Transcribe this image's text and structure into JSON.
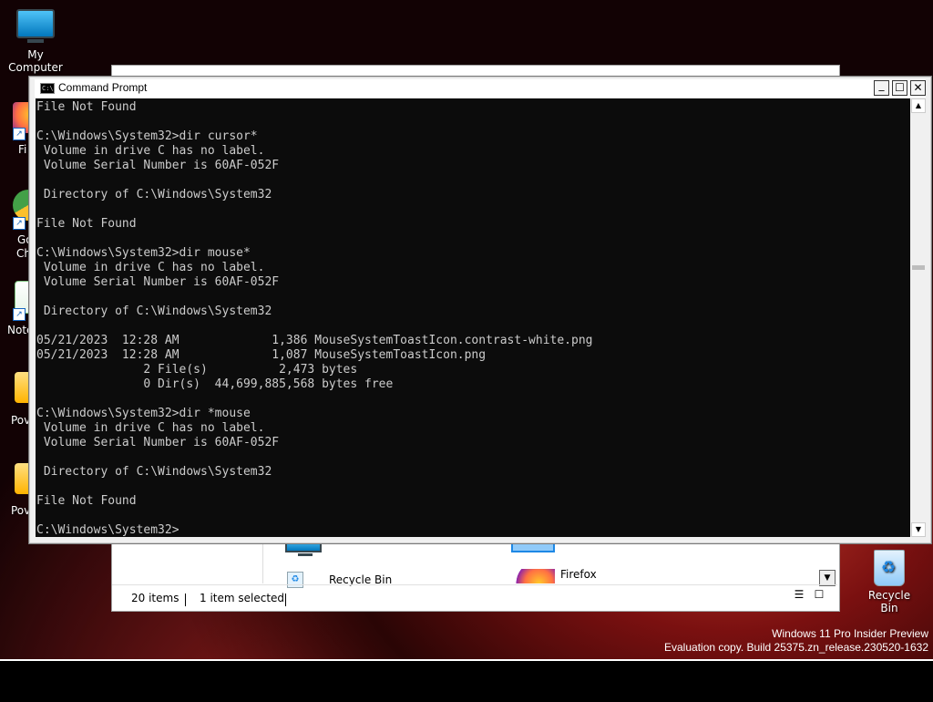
{
  "desktop": {
    "icons": [
      {
        "label": "My Computer",
        "icon": "monitor-icon"
      },
      {
        "label": "Fi",
        "icon": "firefox-icon"
      },
      {
        "label": "Go",
        "label2": "Ch",
        "icon": "chrome-icon"
      },
      {
        "label": "Note",
        "icon": "notepad-icon"
      },
      {
        "label": "Pov",
        "icon": "folder-icon"
      },
      {
        "label": "Pov",
        "icon": "folder-icon"
      }
    ],
    "recycle_bin_label": "Recycle Bin",
    "watermark_line1": "Windows 11 Pro Insider Preview",
    "watermark_line2": "Evaluation copy. Build 25375.zn_release.230520-1632"
  },
  "explorer": {
    "items": [
      {
        "label": "Recycle Bin",
        "icon": "recycle-bin-icon"
      },
      {
        "label": "Firefox",
        "icon": "firefox-icon"
      }
    ],
    "status": {
      "items_count": "20 items",
      "selection": "1 item selected"
    }
  },
  "cmd": {
    "title": "Command Prompt",
    "icon_text": "C:\\",
    "buttons": {
      "minimize": "_",
      "maximize": "☐",
      "close": "✕"
    },
    "output": "File Not Found\n\nC:\\Windows\\System32>dir cursor*\n Volume in drive C has no label.\n Volume Serial Number is 60AF-052F\n\n Directory of C:\\Windows\\System32\n\nFile Not Found\n\nC:\\Windows\\System32>dir mouse*\n Volume in drive C has no label.\n Volume Serial Number is 60AF-052F\n\n Directory of C:\\Windows\\System32\n\n05/21/2023  12:28 AM             1,386 MouseSystemToastIcon.contrast-white.png\n05/21/2023  12:28 AM             1,087 MouseSystemToastIcon.png\n               2 File(s)          2,473 bytes\n               0 Dir(s)  44,699,885,568 bytes free\n\nC:\\Windows\\System32>dir *mouse\n Volume in drive C has no label.\n Volume Serial Number is 60AF-052F\n\n Directory of C:\\Windows\\System32\n\nFile Not Found\n\nC:\\Windows\\System32>"
  },
  "colors": {
    "console_bg": "#0c0c0c",
    "console_fg": "#cccccc",
    "taskbar": "#000000"
  }
}
